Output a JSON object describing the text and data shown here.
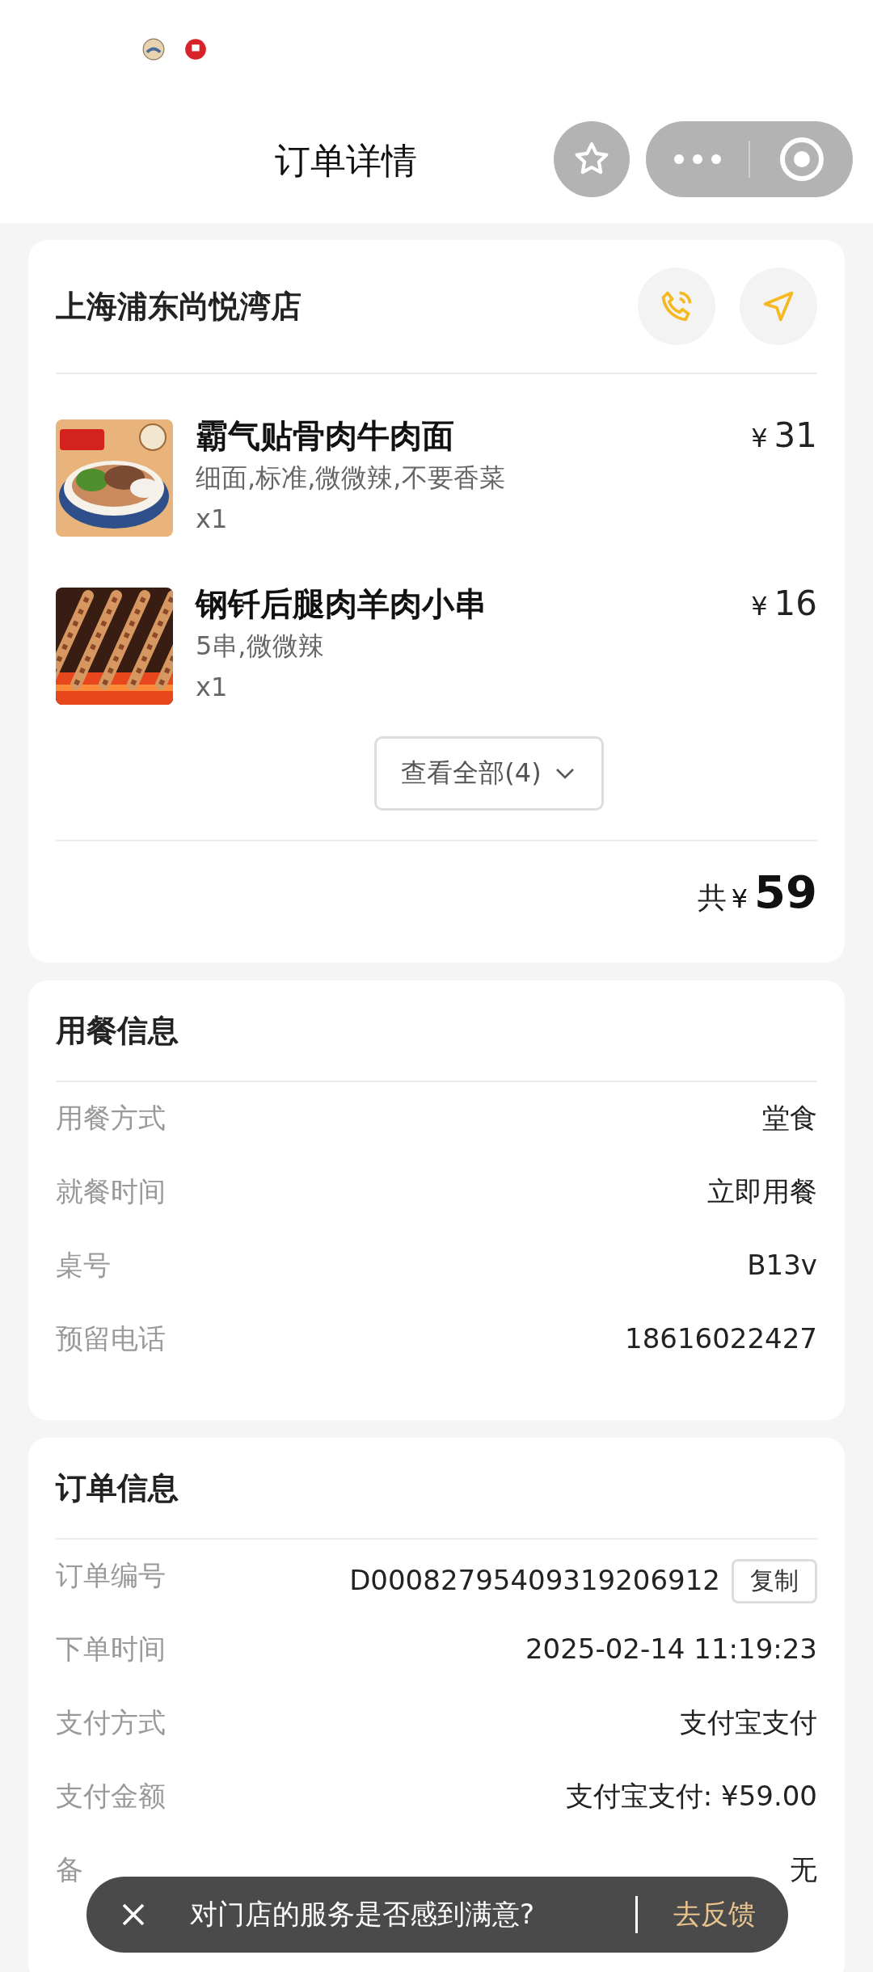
{
  "nav": {
    "title": "订单详情"
  },
  "store": {
    "name": "上海浦东尚悦湾店",
    "items": [
      {
        "name": "霸气贴骨肉牛肉面",
        "options": "细面,标准,微微辣,不要香菜",
        "qty": "x1",
        "price_symbol": "¥",
        "price": "31",
        "kind": "noodles"
      },
      {
        "name": "钢钎后腿肉羊肉小串",
        "options": "5串,微微辣",
        "qty": "x1",
        "price_symbol": "¥",
        "price": "16",
        "kind": "skewers"
      }
    ],
    "view_all": "查看全部(4)",
    "total_label": "共",
    "total_symbol": "¥",
    "total": "59"
  },
  "dining": {
    "title": "用餐信息",
    "rows": [
      {
        "label": "用餐方式",
        "value": "堂食"
      },
      {
        "label": "就餐时间",
        "value": "立即用餐"
      },
      {
        "label": "桌号",
        "value": "B13v"
      },
      {
        "label": "预留电话",
        "value": "18616022427"
      }
    ]
  },
  "order": {
    "title": "订单信息",
    "rows": [
      {
        "label": "订单编号",
        "value": "D00082795409319206912",
        "action": "复制"
      },
      {
        "label": "下单时间",
        "value": "2025-02-14 11:19:23"
      },
      {
        "label": "支付方式",
        "value": "支付宝支付"
      },
      {
        "label": "支付金额",
        "value": "支付宝支付: ¥59.00"
      },
      {
        "label": "备",
        "value": "无"
      }
    ]
  },
  "toast": {
    "message": "对门店的服务是否感到满意?",
    "action": "去反馈"
  }
}
